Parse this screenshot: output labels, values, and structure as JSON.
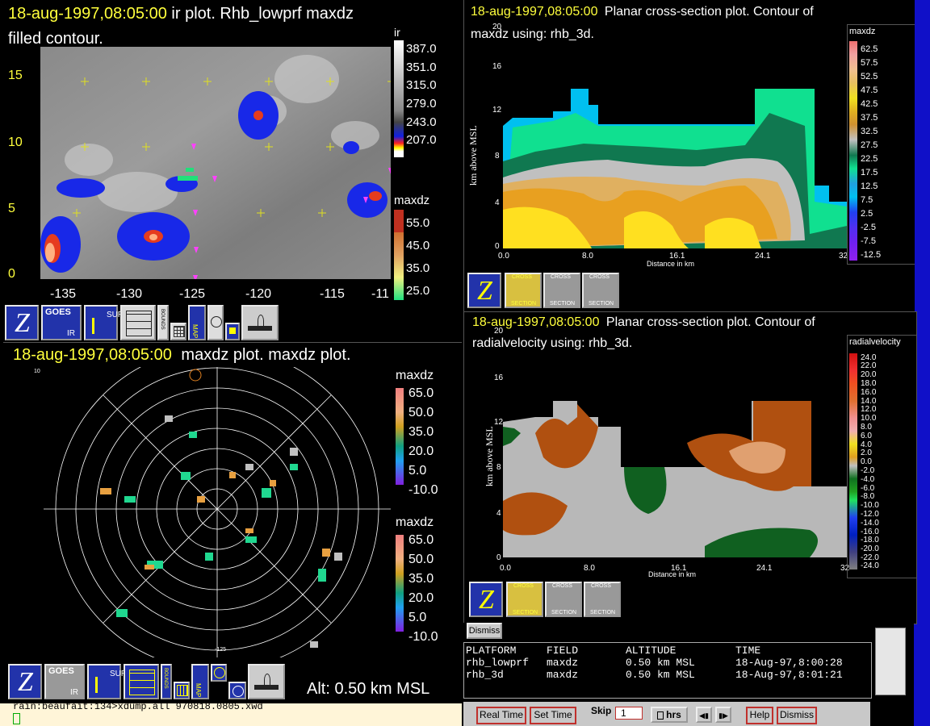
{
  "ir_window": {
    "timestamp": "18-aug-1997,08:05:00",
    "title": "ir plot.  Rhb_lowprf maxdz",
    "subtitle": "filled contour.",
    "y_ticks": [
      "15",
      "10",
      "5",
      "0"
    ],
    "x_ticks": [
      "-135",
      "-130",
      "-125",
      "-120",
      "-115",
      "-11"
    ],
    "colorbar_ir": {
      "title": "ir",
      "labels": [
        "387.0",
        "351.0",
        "315.0",
        "279.0",
        "243.0",
        "207.0"
      ]
    },
    "colorbar_maxdz": {
      "title": "maxdz",
      "labels": [
        "55.0",
        "45.0",
        "35.0",
        "25.0"
      ]
    },
    "icons": [
      "Z",
      "GOES",
      "IR",
      "SUR",
      "BOUNDS",
      "MAP"
    ]
  },
  "xsec_top": {
    "timestamp": "18-aug-1997,08:05:00",
    "title": "Planar cross-section plot.  Contour of",
    "subtitle": "maxdz using: rhb_3d.",
    "ylabel": "km above MSL",
    "xlabel": "Distance in km",
    "y_ticks": [
      "20",
      "16",
      "12",
      "8",
      "4",
      "0"
    ],
    "x_ticks": [
      "0.0",
      "8.0",
      "16.1",
      "24.1",
      "32"
    ],
    "colorbar": {
      "title": "maxdz",
      "labels": [
        "62.5",
        "57.5",
        "52.5",
        "47.5",
        "42.5",
        "37.5",
        "32.5",
        "27.5",
        "22.5",
        "17.5",
        "12.5",
        "7.5",
        "2.5",
        "-2.5",
        "-7.5",
        "-12.5"
      ]
    },
    "buttons": [
      "CROSS",
      "SECTION"
    ]
  },
  "xsec_bottom": {
    "timestamp": "18-aug-1997,08:05:00",
    "title": "Planar cross-section plot.  Contour of",
    "subtitle": "radialvelocity using: rhb_3d.",
    "ylabel": "km above MSL",
    "xlabel": "Distance in km",
    "y_ticks": [
      "20",
      "16",
      "12",
      "8",
      "4",
      "0"
    ],
    "x_ticks": [
      "0.0",
      "8.0",
      "16.1",
      "24.1",
      "32"
    ],
    "colorbar": {
      "title": "radialvelocity",
      "labels": [
        "24.0",
        "22.0",
        "20.0",
        "18.0",
        "16.0",
        "14.0",
        "12.0",
        "10.0",
        "8.0",
        "6.0",
        "4.0",
        "2.0",
        "0.0",
        "-2.0",
        "-4.0",
        "-6.0",
        "-8.0",
        "-10.0",
        "-12.0",
        "-14.0",
        "-16.0",
        "-18.0",
        "-20.0",
        "-22.0",
        "-24.0"
      ]
    },
    "buttons": [
      "CROSS",
      "SECTION"
    ]
  },
  "radar_window": {
    "timestamp": "18-aug-1997,08:05:00",
    "title": "maxdz plot.  maxdz plot.",
    "colorbar1": {
      "title": "maxdz",
      "labels": [
        "65.0",
        "50.0",
        "35.0",
        "20.0",
        "5.0",
        "-10.0"
      ]
    },
    "colorbar2": {
      "title": "maxdz",
      "labels": [
        "65.0",
        "50.0",
        "35.0",
        "20.0",
        "5.0",
        "-10.0"
      ]
    },
    "altitude": "Alt: 0.50 km MSL",
    "top_label": "10",
    "bottom_label": "-125"
  },
  "info_panel": {
    "dismiss_label": "Dismiss",
    "headers": [
      "PLATFORM",
      "FIELD",
      "ALTITUDE",
      "TIME"
    ],
    "rows": [
      [
        "rhb_lowprf",
        "maxdz",
        "0.50 km MSL",
        "18-Aug-97,8:00:28"
      ],
      [
        "rhb_3d",
        "maxdz",
        "0.50 km MSL",
        "18-Aug-97,8:01:21"
      ]
    ]
  },
  "terminal": {
    "command_line": "rain:beaufait:134>xdump.all 970818.0805.xwd"
  },
  "controls": {
    "real_time": "Real Time",
    "set_time": "Set Time",
    "skip": "Skip",
    "skip_value": "1",
    "hrs": "hrs",
    "help": "Help",
    "dismiss": "Dismiss"
  }
}
